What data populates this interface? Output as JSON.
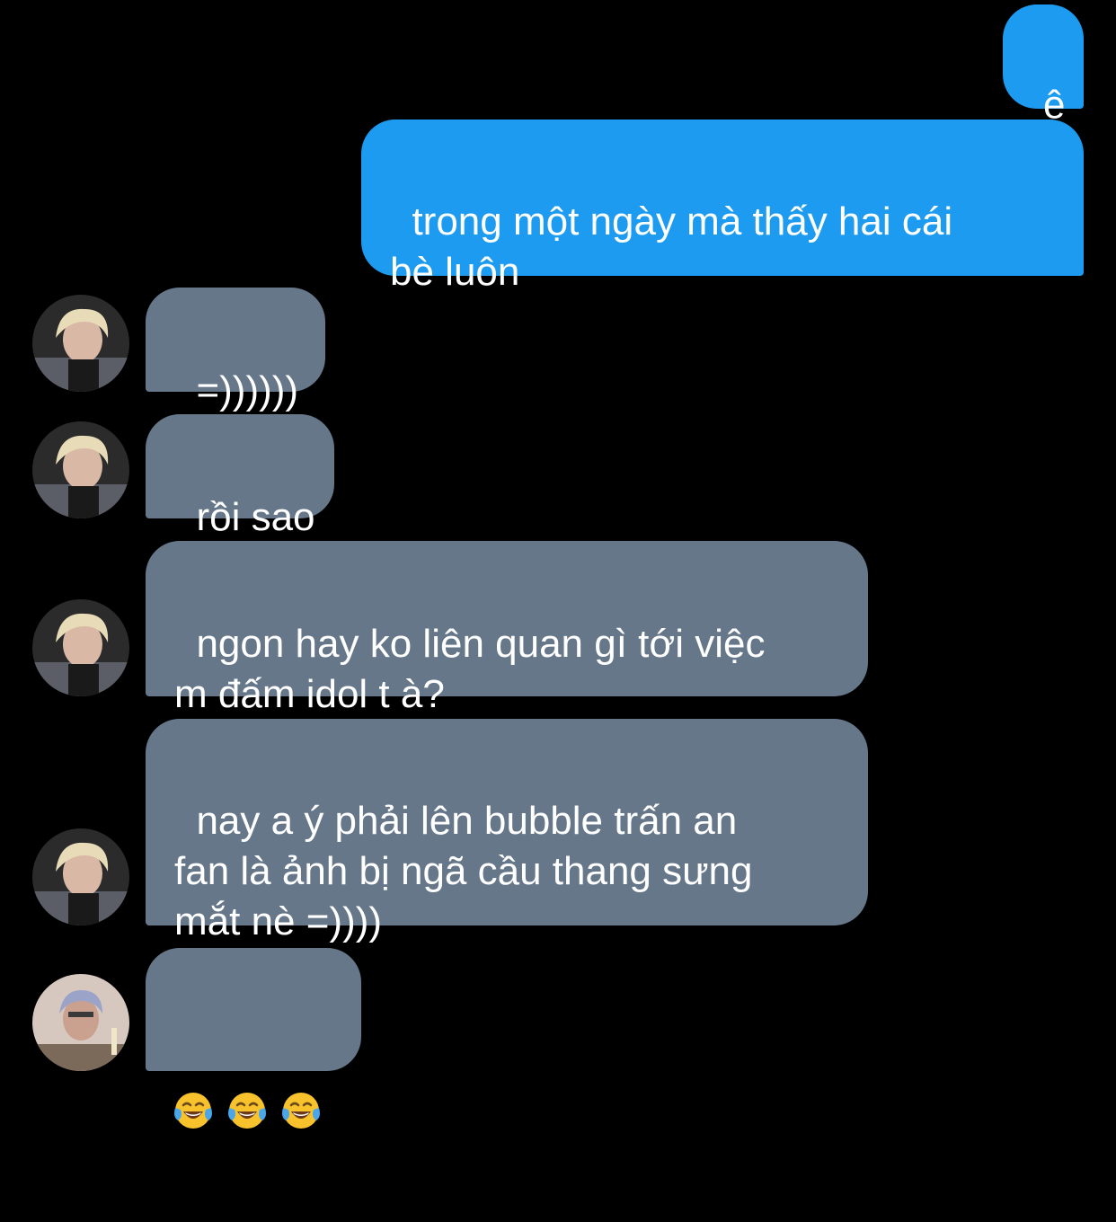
{
  "messages": [
    {
      "id": "m1",
      "side": "sent",
      "text": "ê"
    },
    {
      "id": "m2",
      "side": "sent",
      "text": "trong một ngày mà thấy hai cái\nbè luôn"
    },
    {
      "id": "m3",
      "side": "received",
      "text": "=))))))"
    },
    {
      "id": "m4",
      "side": "received",
      "text": "rồi sao"
    },
    {
      "id": "m5",
      "side": "received",
      "text": "ngon hay ko liên quan gì tới việc\nm đấm idol t à?"
    },
    {
      "id": "m6",
      "side": "received",
      "text": "nay a ý phải lên bubble trấn an\nfan là ảnh bị ngã cầu thang sưng\nmắt nè =))))"
    },
    {
      "id": "m7",
      "side": "received",
      "emoji": [
        "face-with-tears-of-joy",
        "face-with-tears-of-joy",
        "face-with-tears-of-joy"
      ]
    }
  ],
  "colors": {
    "background": "#000000",
    "sent_bubble": "#1d9bf0",
    "received_bubble": "#66778a",
    "text": "#ffffff"
  }
}
